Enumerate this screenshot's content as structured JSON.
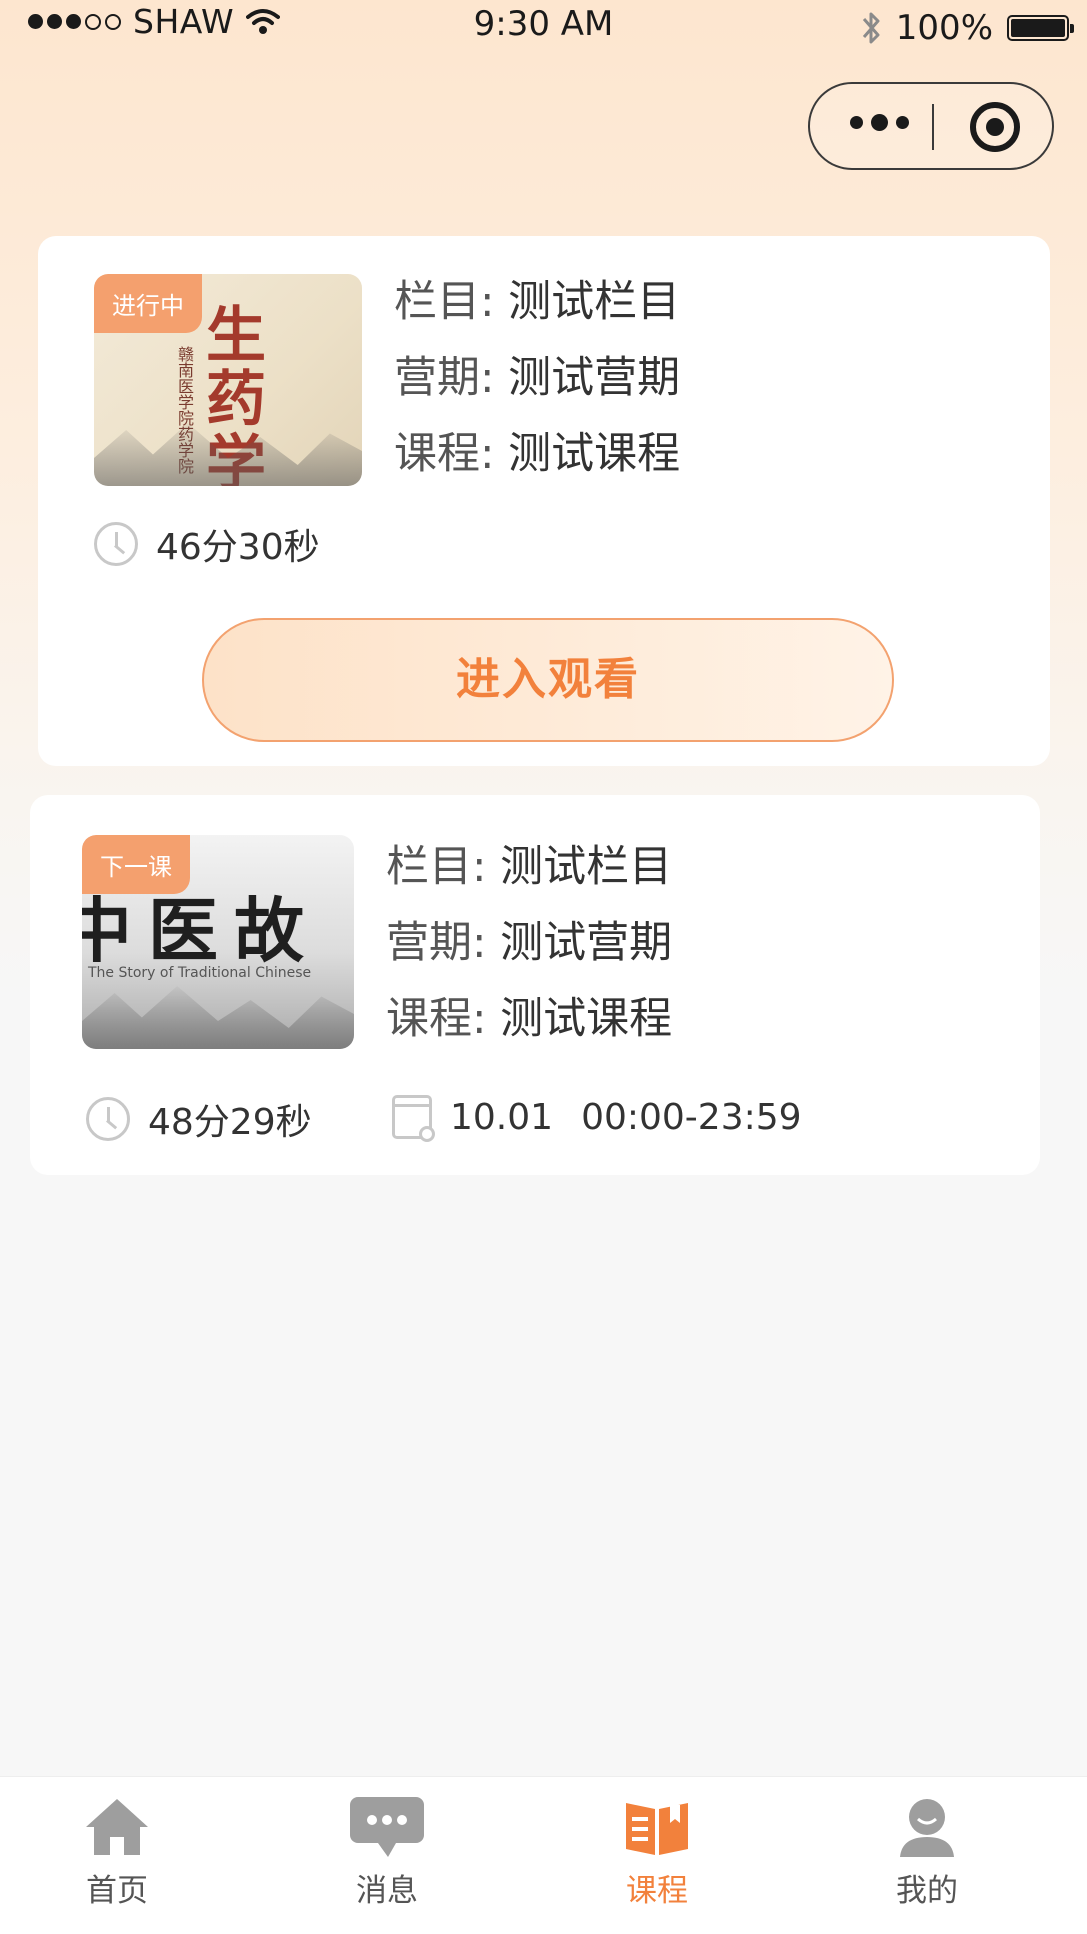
{
  "status_bar": {
    "carrier": "SHAW",
    "time": "9:30 AM",
    "battery": "100%",
    "battery_level": 1.0
  },
  "capsule": {
    "more_icon": "more-dots-icon",
    "close_icon": "target-icon"
  },
  "cards": [
    {
      "badge": "进行中",
      "cover_title": "生药学",
      "cover_subtitle": "赣南医学院药学院",
      "column_label": "栏目:",
      "column_value": "测试栏目",
      "camp_label": "营期:",
      "camp_value": "测试营期",
      "course_label": "课程:",
      "course_value": "测试课程",
      "duration": "46分30秒",
      "button": "进入观看"
    },
    {
      "badge": "下一课",
      "cover_title": "中医故",
      "cover_subtitle": "The Story of Traditional Chinese",
      "column_label": "栏目:",
      "column_value": "测试栏目",
      "camp_label": "营期:",
      "camp_value": "测试营期",
      "course_label": "课程:",
      "course_value": "测试课程",
      "duration": "48分29秒",
      "date": "10.01",
      "time_range": "00:00-23:59"
    }
  ],
  "tabbar": [
    {
      "label": "首页",
      "icon": "home-icon",
      "active": false
    },
    {
      "label": "消息",
      "icon": "message-icon",
      "active": false
    },
    {
      "label": "课程",
      "icon": "course-book-icon",
      "active": true
    },
    {
      "label": "我的",
      "icon": "profile-icon",
      "active": false
    }
  ],
  "colors": {
    "accent": "#f2813c",
    "badge": "#f4a06e",
    "inactive_icon": "#9e9e9e"
  }
}
